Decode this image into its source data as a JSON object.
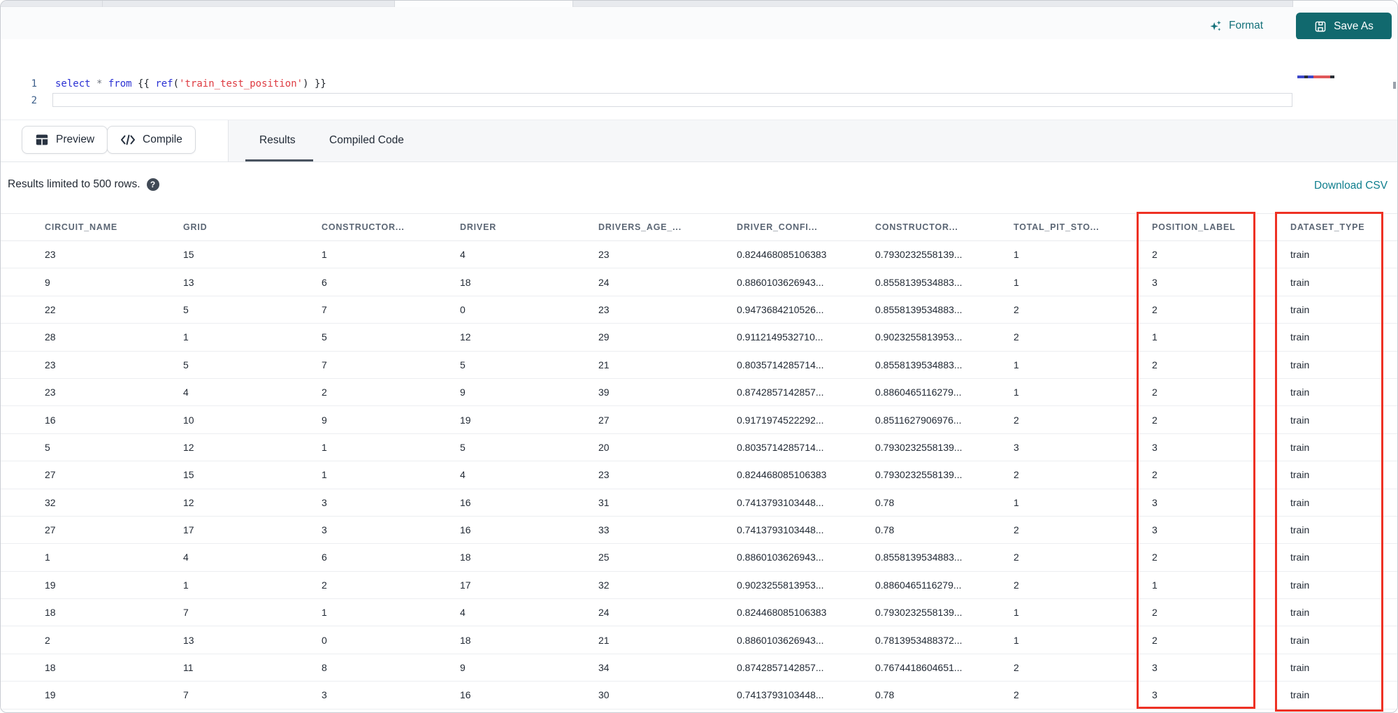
{
  "colors": {
    "accent_teal": "#11696e",
    "format_teal": "#14717a",
    "download_teal": "#0e7e8d",
    "annotation_red": "#ee3124",
    "keyword_blue": "#2b31d3",
    "string_red": "#de3b41"
  },
  "toolbar": {
    "format_label": "Format",
    "save_as_label": "Save As"
  },
  "editor": {
    "lines": [
      {
        "number": "1",
        "tokens": [
          {
            "type": "kw",
            "text": "select "
          },
          {
            "type": "op",
            "text": "* "
          },
          {
            "type": "kw",
            "text": "from "
          },
          {
            "type": "brace",
            "text": "{{ "
          },
          {
            "type": "fn",
            "text": "ref"
          },
          {
            "type": "brace",
            "text": "("
          },
          {
            "type": "str",
            "text": "'train_test_position'"
          },
          {
            "type": "brace",
            "text": ") "
          },
          {
            "type": "brace",
            "text": "}}"
          }
        ]
      },
      {
        "number": "2",
        "tokens": []
      }
    ],
    "minimap_segments": [
      {
        "color": "#3d47c9",
        "width": 10
      },
      {
        "color": "#2b2f36",
        "width": 5
      },
      {
        "color": "#3d47c9",
        "width": 8
      },
      {
        "color": "#e0575a",
        "width": 24
      },
      {
        "color": "#2b2f36",
        "width": 6
      }
    ]
  },
  "actions": {
    "preview_label": "Preview",
    "compile_label": "Compile"
  },
  "tabs": [
    {
      "label": "Results",
      "active": true
    },
    {
      "label": "Compiled Code",
      "active": false
    }
  ],
  "results_bar": {
    "limit_text": "Results limited to 500 rows.",
    "help_icon": "?",
    "download_label": "Download CSV"
  },
  "table": {
    "columns": [
      "CIRCUIT_NAME",
      "GRID",
      "CONSTRUCTOR...",
      "DRIVER",
      "DRIVERS_AGE_...",
      "DRIVER_CONFI...",
      "CONSTRUCTOR...",
      "TOTAL_PIT_STO...",
      "POSITION_LABEL",
      "DATASET_TYPE"
    ],
    "highlighted_columns": [
      "POSITION_LABEL",
      "DATASET_TYPE"
    ],
    "rows": [
      [
        "23",
        "15",
        "1",
        "4",
        "23",
        "0.824468085106383",
        "0.7930232558139...",
        "1",
        "2",
        "train"
      ],
      [
        "9",
        "13",
        "6",
        "18",
        "24",
        "0.8860103626943...",
        "0.8558139534883...",
        "1",
        "3",
        "train"
      ],
      [
        "22",
        "5",
        "7",
        "0",
        "23",
        "0.9473684210526...",
        "0.8558139534883...",
        "2",
        "2",
        "train"
      ],
      [
        "28",
        "1",
        "5",
        "12",
        "29",
        "0.9112149532710...",
        "0.9023255813953...",
        "2",
        "1",
        "train"
      ],
      [
        "23",
        "5",
        "7",
        "5",
        "21",
        "0.8035714285714...",
        "0.8558139534883...",
        "1",
        "2",
        "train"
      ],
      [
        "23",
        "4",
        "2",
        "9",
        "39",
        "0.8742857142857...",
        "0.8860465116279...",
        "1",
        "2",
        "train"
      ],
      [
        "16",
        "10",
        "9",
        "19",
        "27",
        "0.9171974522292...",
        "0.8511627906976...",
        "2",
        "2",
        "train"
      ],
      [
        "5",
        "12",
        "1",
        "5",
        "20",
        "0.8035714285714...",
        "0.7930232558139...",
        "3",
        "3",
        "train"
      ],
      [
        "27",
        "15",
        "1",
        "4",
        "23",
        "0.824468085106383",
        "0.7930232558139...",
        "2",
        "2",
        "train"
      ],
      [
        "32",
        "12",
        "3",
        "16",
        "31",
        "0.7413793103448...",
        "0.78",
        "1",
        "3",
        "train"
      ],
      [
        "27",
        "17",
        "3",
        "16",
        "33",
        "0.7413793103448...",
        "0.78",
        "2",
        "3",
        "train"
      ],
      [
        "1",
        "4",
        "6",
        "18",
        "25",
        "0.8860103626943...",
        "0.8558139534883...",
        "2",
        "2",
        "train"
      ],
      [
        "19",
        "1",
        "2",
        "17",
        "32",
        "0.9023255813953...",
        "0.8860465116279...",
        "2",
        "1",
        "train"
      ],
      [
        "18",
        "7",
        "1",
        "4",
        "24",
        "0.824468085106383",
        "0.7930232558139...",
        "1",
        "2",
        "train"
      ],
      [
        "2",
        "13",
        "0",
        "18",
        "21",
        "0.8860103626943...",
        "0.7813953488372...",
        "1",
        "2",
        "train"
      ],
      [
        "18",
        "11",
        "8",
        "9",
        "34",
        "0.8742857142857...",
        "0.7674418604651...",
        "2",
        "3",
        "train"
      ],
      [
        "19",
        "7",
        "3",
        "16",
        "30",
        "0.7413793103448...",
        "0.78",
        "2",
        "3",
        "train"
      ]
    ]
  }
}
